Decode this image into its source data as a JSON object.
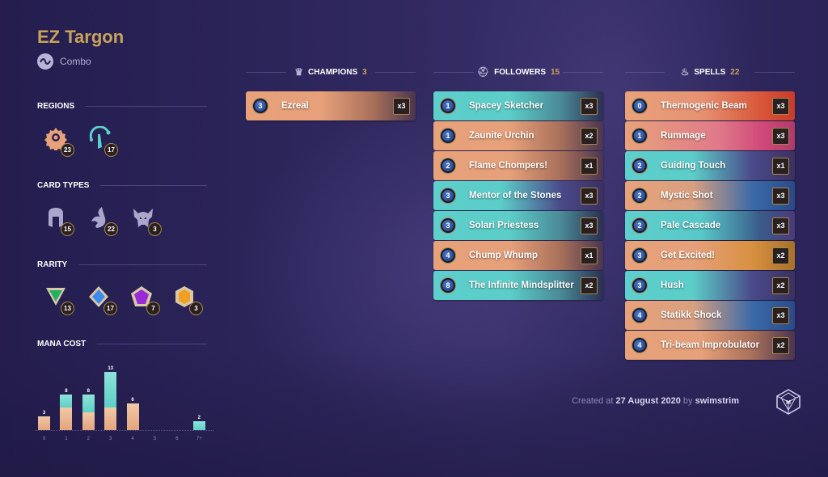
{
  "deck": {
    "title": "EZ Targon",
    "archetype": "Combo",
    "archetype_icon": "combo-icon"
  },
  "sidebar": {
    "regions": {
      "label": "REGIONS",
      "items": [
        {
          "name": "Piltover & Zaun",
          "icon": "piltover-zaun-icon",
          "count": "23",
          "color": "#e8a27a"
        },
        {
          "name": "Targon",
          "icon": "targon-icon",
          "count": "17",
          "color": "#5dcfcc"
        }
      ]
    },
    "card_types": {
      "label": "CARD TYPES",
      "items": [
        {
          "name": "Followers",
          "icon": "follower-icon",
          "count": "15"
        },
        {
          "name": "Spells",
          "icon": "spell-icon",
          "count": "22"
        },
        {
          "name": "Champions",
          "icon": "champion-icon",
          "count": "3"
        }
      ]
    },
    "rarity": {
      "label": "RARITY",
      "items": [
        {
          "name": "Common",
          "icon": "common-rarity-icon",
          "count": "13",
          "color": "#22b060"
        },
        {
          "name": "Rare",
          "icon": "rare-rarity-icon",
          "count": "17",
          "color": "#3a8af0"
        },
        {
          "name": "Epic",
          "icon": "epic-rarity-icon",
          "count": "7",
          "color": "#9a2ad8"
        },
        {
          "name": "Champion",
          "icon": "champion-rarity-icon",
          "count": "3",
          "color": "#f0a020"
        }
      ]
    },
    "mana_cost": {
      "label": "MANA COST"
    }
  },
  "chart_data": {
    "type": "bar",
    "title": "MANA COST",
    "categories": [
      "0",
      "1",
      "2",
      "3",
      "4",
      "5",
      "6",
      "7+"
    ],
    "totals": [
      3,
      8,
      8,
      13,
      6,
      0,
      0,
      2
    ],
    "series": [
      {
        "name": "Piltover & Zaun",
        "color": "#e8a27a",
        "values": [
          3,
          5,
          4,
          5,
          6,
          0,
          0,
          0
        ]
      },
      {
        "name": "Targon",
        "color": "#5dcfcc",
        "values": [
          0,
          3,
          4,
          8,
          0,
          0,
          0,
          2
        ]
      }
    ],
    "stacked": true,
    "xlabel": "",
    "ylabel": "",
    "ylim": [
      0,
      13
    ],
    "grid": false
  },
  "columns": {
    "champions": {
      "label": "CHAMPIONS",
      "count": "3",
      "icon": "champion-icon",
      "cards": [
        {
          "cost": "3",
          "name": "Ezreal",
          "qty": "x3",
          "style": "orange"
        }
      ]
    },
    "followers": {
      "label": "FOLLOWERS",
      "count": "15",
      "icon": "follower-icon",
      "cards": [
        {
          "cost": "1",
          "name": "Spacey Sketcher",
          "qty": "x3",
          "style": "teal"
        },
        {
          "cost": "1",
          "name": "Zaunite Urchin",
          "qty": "x2",
          "style": "orange"
        },
        {
          "cost": "2",
          "name": "Flame Chompers!",
          "qty": "x1",
          "style": "orange"
        },
        {
          "cost": "3",
          "name": "Mentor of the Stones",
          "qty": "x3",
          "style": "tealpurple"
        },
        {
          "cost": "3",
          "name": "Solari Priestess",
          "qty": "x3",
          "style": "teal"
        },
        {
          "cost": "4",
          "name": "Chump Whump",
          "qty": "x1",
          "style": "orange"
        },
        {
          "cost": "8",
          "name": "The Infinite Mindsplitter",
          "qty": "x2",
          "style": "teal"
        }
      ]
    },
    "spells": {
      "label": "SPELLS",
      "count": "22",
      "icon": "spell-icon",
      "cards": [
        {
          "cost": "0",
          "name": "Thermogenic Beam",
          "qty": "x3",
          "style": "red"
        },
        {
          "cost": "1",
          "name": "Rummage",
          "qty": "x3",
          "style": "pink"
        },
        {
          "cost": "2",
          "name": "Guiding Touch",
          "qty": "x1",
          "style": "tealpurple"
        },
        {
          "cost": "2",
          "name": "Mystic Shot",
          "qty": "x3",
          "style": "blue"
        },
        {
          "cost": "2",
          "name": "Pale Cascade",
          "qty": "x3",
          "style": "tealblue"
        },
        {
          "cost": "3",
          "name": "Get Excited!",
          "qty": "x2",
          "style": "orangegold"
        },
        {
          "cost": "3",
          "name": "Hush",
          "qty": "x2",
          "style": "tealpurple"
        },
        {
          "cost": "4",
          "name": "Statikk Shock",
          "qty": "x3",
          "style": "blue"
        },
        {
          "cost": "4",
          "name": "Tri-beam Improbulator",
          "qty": "x2",
          "style": "orange"
        }
      ]
    }
  },
  "footer": {
    "prefix": "Created at",
    "date": "27 August 2020",
    "by": "by",
    "author": "swimstrim",
    "logo": "mobalytics-logo-icon"
  }
}
